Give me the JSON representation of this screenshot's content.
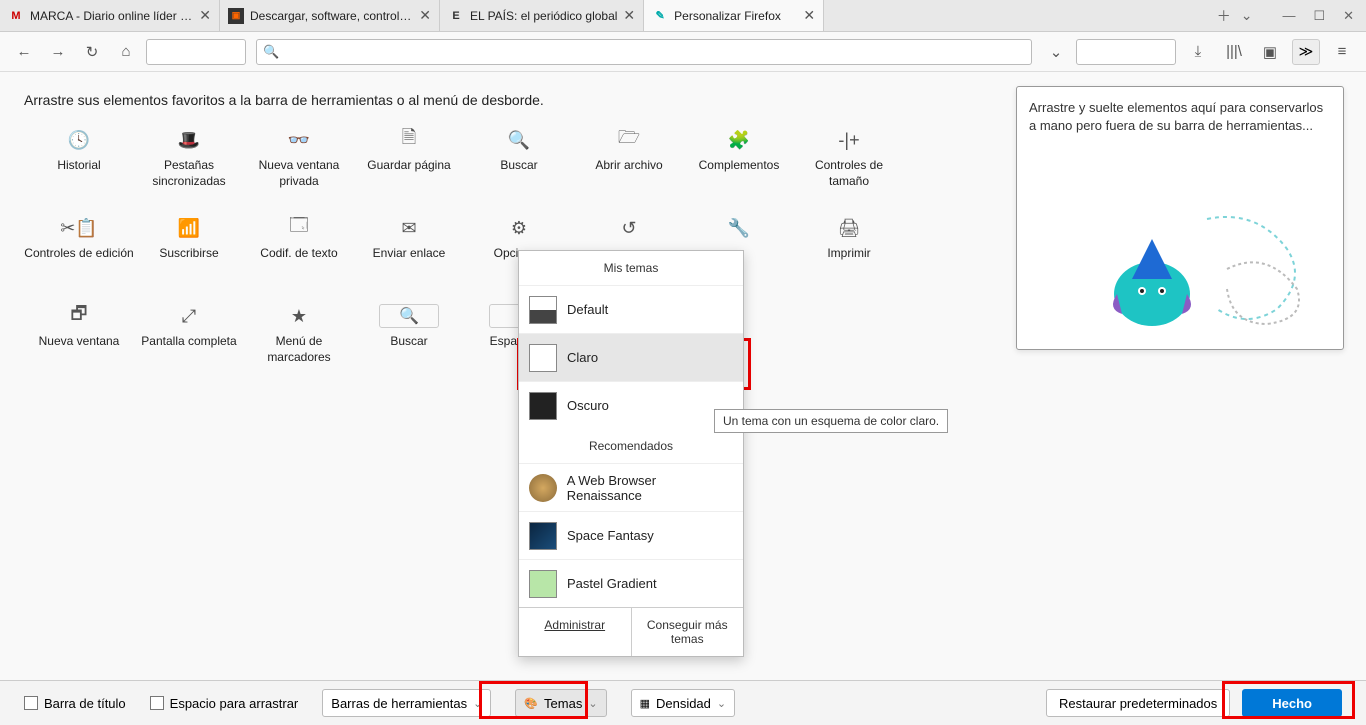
{
  "tabs": {
    "t0": {
      "favicon": "M",
      "faviconColor": "#c00",
      "title": "MARCA - Diario online líder en"
    },
    "t1": {
      "favicon": "▣",
      "faviconColor": "#f60",
      "title": "Descargar, software, controlado"
    },
    "t2": {
      "favicon": "E",
      "faviconColor": "#333",
      "title": "EL PAÍS: el periódico global"
    },
    "t3": {
      "favicon": "✎",
      "faviconColor": "#0aa",
      "title": "Personalizar Firefox"
    },
    "newTab": "＋",
    "dropdown": "⌄"
  },
  "windowControls": {
    "min": "—",
    "max": "☐",
    "close": "✕"
  },
  "toolbar": {
    "back": "←",
    "forward": "→",
    "reload": "↻",
    "home": "⌂",
    "searchIcon": "🔍",
    "dropdownCaret": "⌄",
    "download": "⤓",
    "library": "|||\\",
    "sidebar": "▣",
    "more": "≫",
    "menu": "≡"
  },
  "instruction": "Arrastre sus elementos favoritos a la barra de herramientas o al menú de desborde.",
  "items": {
    "history": {
      "icon": "🕓",
      "label": "Historial"
    },
    "syncedTabs": {
      "icon": "🎩",
      "label": "Pestañas sincronizadas"
    },
    "privateWindow": {
      "icon": "👓",
      "label": "Nueva ventana privada"
    },
    "savePage": {
      "icon": "🗎",
      "label": "Guardar página"
    },
    "search": {
      "icon": "🔍",
      "label": "Buscar"
    },
    "openFile": {
      "icon": "🗁",
      "label": "Abrir archivo"
    },
    "addons": {
      "icon": "🧩",
      "label": "Complementos"
    },
    "zoom": {
      "icon": "-|+",
      "label": "Controles de tamaño"
    },
    "editControls": {
      "icon": "✂📋",
      "label": "Controles de edición"
    },
    "subscribe": {
      "icon": "📶",
      "label": "Suscribirse"
    },
    "encoding": {
      "icon": "🗔",
      "label": "Codif. de texto"
    },
    "sendLink": {
      "icon": "✉",
      "label": "Enviar enlace"
    },
    "options": {
      "icon": "⚙",
      "label": "Opciones"
    },
    "history2": {
      "icon": "↺",
      "label": ""
    },
    "devtools": {
      "icon": "🔧",
      "label": ""
    },
    "print": {
      "icon": "🖨",
      "label": "Imprimir"
    },
    "newWindow": {
      "icon": "🗗",
      "label": "Nueva ventana"
    },
    "fullscreen": {
      "icon": "⤢",
      "label": "Pantalla completa"
    },
    "bookmarksMenu": {
      "icon": "★",
      "label": "Menú de marcadores"
    },
    "searchBox": {
      "icon": "🔍",
      "label": "Buscar"
    },
    "flexSpace": {
      "icon": "",
      "label": "Espacio fle"
    }
  },
  "overflowHint": "Arrastre y suelte elementos aquí para conservarlos a mano pero fuera de su barra de herramientas...",
  "themes": {
    "header": "Mis temas",
    "default": "Default",
    "light": "Claro",
    "dark": "Oscuro",
    "recommended": "Recomendados",
    "renaissance": "A Web Browser Renaissance",
    "space": "Space Fantasy",
    "pastel": "Pastel Gradient",
    "manage": "Administrar",
    "getMore": "Conseguir más temas"
  },
  "tooltip": "Un tema con un esquema de color claro.",
  "bottom": {
    "titleBar": "Barra de título",
    "dragSpace": "Espacio para arrastrar",
    "toolbars": "Barras de herramientas",
    "themes": "Temas",
    "density": "Densidad",
    "restore": "Restaurar predeterminados",
    "done": "Hecho"
  }
}
